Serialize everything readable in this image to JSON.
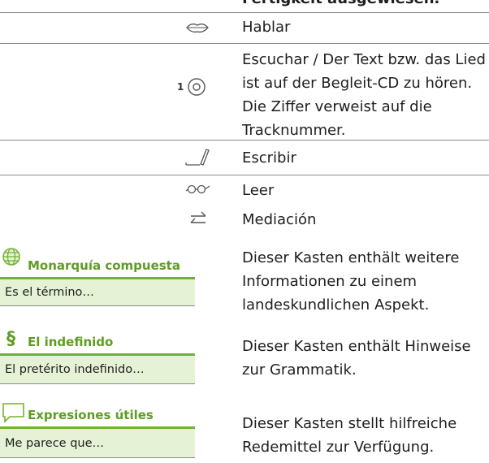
{
  "header_cut": "Fertigkeit ausgewiesen.",
  "legend": [
    {
      "icon": "lips-icon",
      "text": "Hablar"
    },
    {
      "icon": "cd-icon",
      "track": "1",
      "text": "Escuchar / Der Text bzw. das Lied ist auf der Begleit-CD zu hören. Die Ziffer verweist auf die Tracknummer."
    },
    {
      "icon": "pencil-icon",
      "text": "Escribir"
    },
    {
      "icon": "glasses-icon",
      "text": "Leer"
    },
    {
      "icon": "exchange-arrows-icon",
      "text": "Mediación"
    }
  ],
  "boxes": [
    {
      "icon": "globe-icon",
      "title": "Monarquía compuesta",
      "example": "Es el término…",
      "desc": "Dieser Kasten enthält weitere Informationen zu einem landeskundlichen Aspekt."
    },
    {
      "icon": "paragraph-icon",
      "glyph": "§",
      "title": "El indefinido",
      "example": "El pretérito indefinido…",
      "desc": "Dieser Kasten enthält Hinweise zur Grammatik."
    },
    {
      "icon": "speech-bubble-icon",
      "title": "Expresiones útiles",
      "example": "Me parece que…",
      "desc": "Dieser Kasten stellt hilfreiche Redemittel zur Verfügung."
    }
  ],
  "colors": {
    "accent_green": "#72b232",
    "title_green": "#5f9c23",
    "box_fill": "#e6f2d6",
    "rule": "#8a8a8a"
  }
}
